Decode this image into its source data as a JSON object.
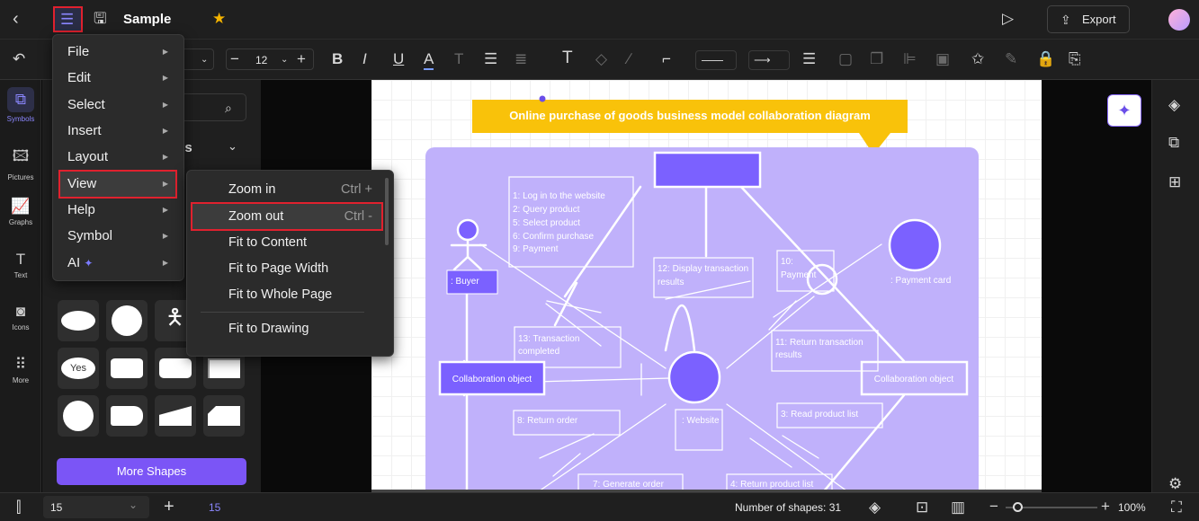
{
  "header": {
    "title": "Sample",
    "export_label": "Export"
  },
  "toolbar": {
    "font_size": "12"
  },
  "rail": [
    {
      "label": "Symbols",
      "glyph": "⧉"
    },
    {
      "label": "Pictures",
      "glyph": "🖾"
    },
    {
      "label": "Graphs",
      "glyph": "📈"
    },
    {
      "label": "Text",
      "glyph": "T"
    },
    {
      "label": "Icons",
      "glyph": "◙"
    },
    {
      "label": "More",
      "glyph": "⠿"
    }
  ],
  "panel": {
    "section_fragment": "es",
    "yes_shape_label": "Yes",
    "more_shapes_label": "More Shapes"
  },
  "main_menu": [
    {
      "label": "File"
    },
    {
      "label": "Edit"
    },
    {
      "label": "Select"
    },
    {
      "label": "Insert"
    },
    {
      "label": "Layout"
    },
    {
      "label": "View"
    },
    {
      "label": "Help"
    },
    {
      "label": "Symbol"
    },
    {
      "label": "AI"
    }
  ],
  "view_submenu": [
    {
      "label": "Zoom in",
      "shortcut": "Ctrl +"
    },
    {
      "label": "Zoom out",
      "shortcut": "Ctrl -"
    },
    {
      "label": "Fit to Content"
    },
    {
      "label": "Fit to Page Width"
    },
    {
      "label": "Fit to Whole Page"
    },
    {
      "label": "Fit to Drawing"
    }
  ],
  "diagram": {
    "title": "Online purchase of goods business model collaboration diagram",
    "messages_1": [
      "1: Log in to the website",
      "2: Query product",
      "5: Select product",
      "6: Confirm purchase",
      "9: Payment"
    ],
    "msg12": [
      "12: Display transaction",
      "results"
    ],
    "msg10": [
      "10:",
      "Payment"
    ],
    "buyer": ": Buyer",
    "payment_card": ": Payment card",
    "msg13": [
      "13: Transaction",
      "completed"
    ],
    "msg11": [
      "11: Return transaction",
      "results"
    ],
    "collab_left": "Collaboration object",
    "collab_right": "Collaboration object",
    "website": ": Website",
    "msg8": "8: Return order",
    "msg3": "3: Read product list",
    "msg7": "7: Generate order",
    "msg4": "4: Return product list",
    "colors": {
      "title_bg": "#f9c20a",
      "panel_bg": "#c0b1fb",
      "object_fill": "#7b61ff"
    }
  },
  "bottom": {
    "page_select": "15",
    "page_tab": "15",
    "shape_count": "Number of shapes: 31",
    "zoom": "100%"
  },
  "colors": {
    "accent": "#7b61ff",
    "highlight_border": "#e0212e"
  }
}
